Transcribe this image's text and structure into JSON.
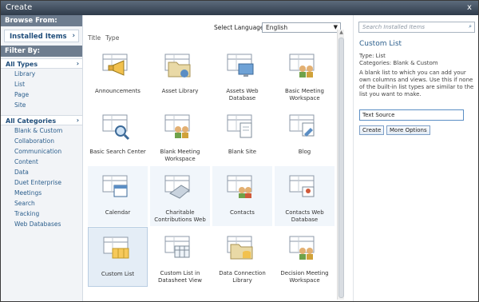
{
  "window": {
    "title": "Create",
    "close_glyph": "x"
  },
  "leftnav": {
    "browse_header": "Browse From:",
    "browse_selected": "Installed Items",
    "filter_header": "Filter By:",
    "types_header": "All Types",
    "types": [
      "Library",
      "List",
      "Page",
      "Site"
    ],
    "categories_header": "All Categories",
    "categories": [
      "Blank & Custom",
      "Collaboration",
      "Communication",
      "Content",
      "Data",
      "Duet Enterprise",
      "Meetings",
      "Search",
      "Tracking",
      "Web Databases"
    ]
  },
  "center": {
    "language_label": "Select Language:",
    "language_value": "English",
    "sort_title": "Title",
    "sort_type": "Type",
    "items": [
      {
        "label": "Announcements",
        "icon": "megaphone-icon"
      },
      {
        "label": "Asset Library",
        "icon": "folder-icon"
      },
      {
        "label": "Assets Web Database",
        "icon": "monitor-icon"
      },
      {
        "label": "Basic Meeting Workspace",
        "icon": "people-icon"
      },
      {
        "label": "Basic Search Center",
        "icon": "magnifier-icon"
      },
      {
        "label": "Blank Meeting Workspace",
        "icon": "people-icon"
      },
      {
        "label": "Blank Site",
        "icon": "document-icon"
      },
      {
        "label": "Blog",
        "icon": "blog-icon"
      },
      {
        "label": "Calendar",
        "icon": "calendar-icon"
      },
      {
        "label": "Charitable Contributions Web",
        "icon": "hand-icon"
      },
      {
        "label": "Contacts",
        "icon": "contacts-icon"
      },
      {
        "label": "Contacts Web Database",
        "icon": "contact-card-icon"
      },
      {
        "label": "Custom List",
        "icon": "list-icon"
      },
      {
        "label": "Custom List in Datasheet View",
        "icon": "datasheet-icon"
      },
      {
        "label": "Data Connection Library",
        "icon": "database-icon"
      },
      {
        "label": "Decision Meeting Workspace",
        "icon": "people-icon"
      }
    ]
  },
  "details": {
    "search_placeholder": "Search Installed Items",
    "title": "Custom List",
    "type_line": "Type: List",
    "categories_line": "Categories: Blank & Custom",
    "description": "A blank list to which you can add your own columns and views. Use this if none of the built-in list types are similar to the list you want to make.",
    "name_value": "Text Source",
    "create_label": "Create",
    "more_options_label": "More Options"
  },
  "colors": {
    "accent": "#2b5e8c",
    "header": "#6e7d8f",
    "selected_tile": "#e4edf6"
  }
}
